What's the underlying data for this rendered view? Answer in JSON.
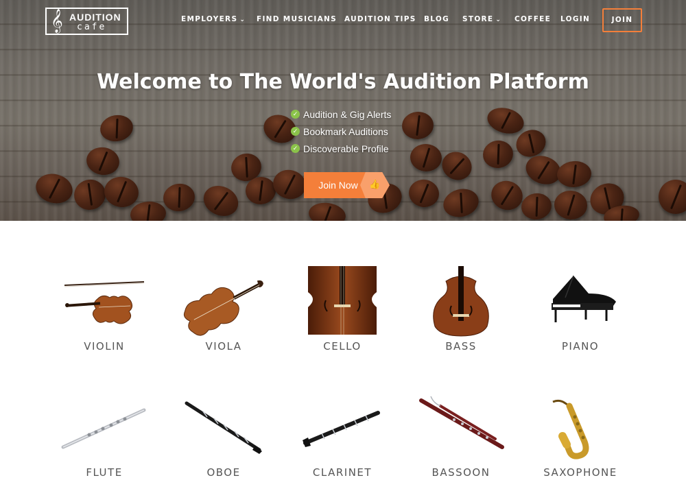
{
  "logo": {
    "glyph": "𝄞",
    "top_text": "AUDITION",
    "bottom_text": "cafe"
  },
  "nav": {
    "items": [
      {
        "label": "EMPLOYERS",
        "has_dropdown": true
      },
      {
        "label": "FIND MUSICIANS",
        "has_dropdown": false
      },
      {
        "label": "AUDITION TIPS",
        "has_dropdown": false
      },
      {
        "label": "BLOG",
        "has_dropdown": false
      },
      {
        "label": "STORE",
        "has_dropdown": true
      },
      {
        "label": "COFFEE",
        "has_dropdown": false
      },
      {
        "label": "LOGIN",
        "has_dropdown": false
      }
    ],
    "join_label": "JOIN",
    "chevron_glyph": "⌄"
  },
  "hero": {
    "title": "Welcome to The World's Audition Platform",
    "check_glyph": "✓",
    "features": [
      "Audition & Gig Alerts",
      "Bookmark Auditions",
      "Discoverable Profile"
    ],
    "cta_label": "Join Now",
    "cta_icon": "👍"
  },
  "instruments": [
    {
      "label": "VIOLIN"
    },
    {
      "label": "VIOLA"
    },
    {
      "label": "CELLO"
    },
    {
      "label": "BASS"
    },
    {
      "label": "PIANO"
    },
    {
      "label": "FLUTE"
    },
    {
      "label": "OBOE"
    },
    {
      "label": "CLARINET"
    },
    {
      "label": "BASSOON"
    },
    {
      "label": "SAXOPHONE"
    }
  ],
  "colors": {
    "accent_orange": "#f47f3a",
    "cta_tip": "#f9a06b",
    "check_green": "#8bc34a",
    "label_gray": "#555555"
  }
}
